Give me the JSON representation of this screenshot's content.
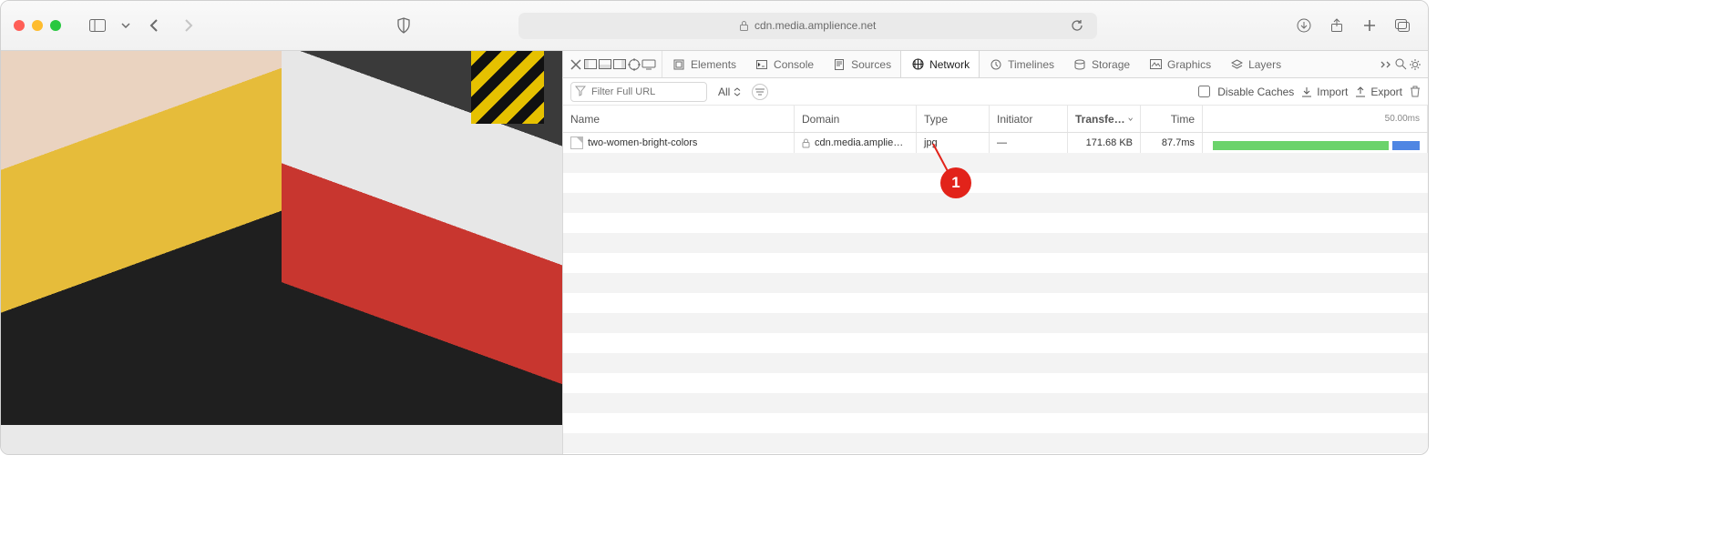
{
  "toolbar": {
    "url_host": "cdn.media.amplience.net"
  },
  "devtools": {
    "tabs": {
      "elements": "Elements",
      "console": "Console",
      "sources": "Sources",
      "network": "Network",
      "timelines": "Timelines",
      "storage": "Storage",
      "graphics": "Graphics",
      "layers": "Layers"
    },
    "filter": {
      "placeholder": "Filter Full URL",
      "scope": "All",
      "disable_caches": "Disable Caches",
      "import": "Import",
      "export": "Export"
    },
    "columns": {
      "name": "Name",
      "domain": "Domain",
      "type": "Type",
      "initiator": "Initiator",
      "transfer": "Transfe…",
      "time": "Time",
      "waterfall_scale": "50.00ms"
    },
    "rows": [
      {
        "name": "two-women-bright-colors",
        "domain": "cdn.media.amplie…",
        "type": "jpg",
        "initiator": "—",
        "transfer": "171.68 KB",
        "time": "87.7ms"
      }
    ]
  },
  "annotation": {
    "label": "1"
  }
}
